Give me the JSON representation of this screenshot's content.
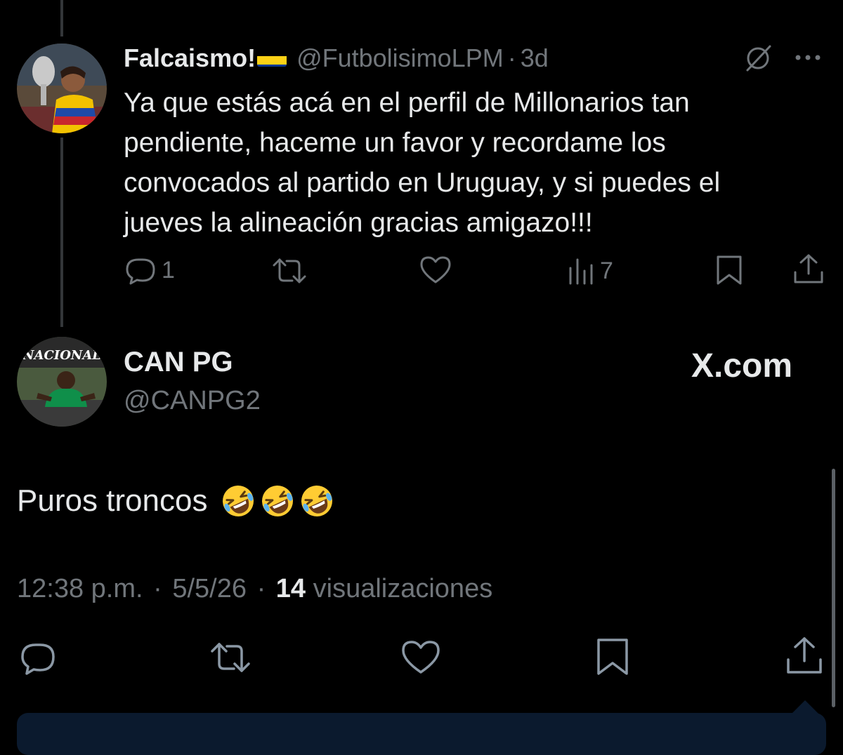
{
  "reply": {
    "display_name": "Falcaismo!",
    "handle": "@FutbolisimoLPM",
    "separator": "·",
    "time": "3d",
    "body_lines": [
      "Ya que estás acá en el perfil de Millonarios tan",
      "pendiente, haceme un favor y recordame los",
      "convocados al partido en Uruguay, y si puedes el",
      "jueves la alineación gracias amigazo!!!"
    ],
    "reply_count": "1",
    "views_count": "7"
  },
  "main": {
    "display_name": "CAN PG",
    "handle": "@CANPG2",
    "watermark": "X.com",
    "avatar_text": "NACIONAL",
    "body": "Puros troncos",
    "emoji_count": 3,
    "timestamp_time": "12:38 p.m.",
    "dot": "·",
    "timestamp_date": "5/5/26",
    "views_number": "14",
    "views_label": "visualizaciones"
  },
  "colors": {
    "background": "#000000",
    "text": "#e7e9ea",
    "muted": "#71767b",
    "flag_yellow": "#fcd116",
    "flag_blue": "#003893",
    "flag_red": "#ce1126",
    "composer": "#0b1a2e"
  },
  "icons": [
    "reply-icon",
    "retweet-icon",
    "like-icon",
    "views-icon",
    "bookmark-icon",
    "share-icon",
    "grok-icon",
    "more-icon"
  ]
}
